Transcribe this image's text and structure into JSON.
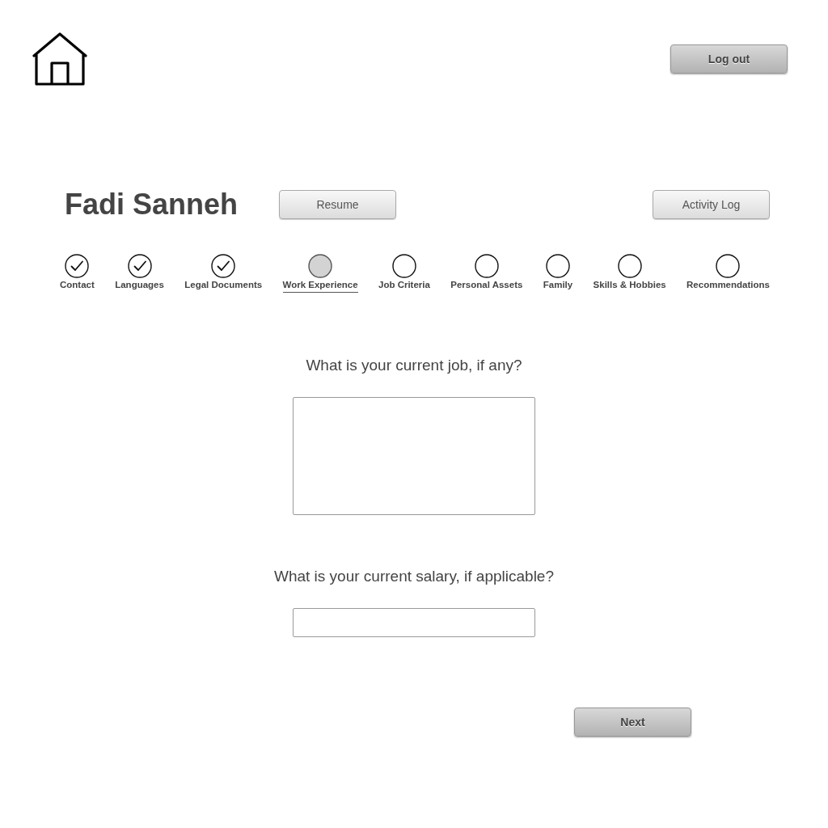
{
  "header": {
    "logout_button": "Log out"
  },
  "profile": {
    "name": "Fadi Sanneh",
    "resume_button": "Resume",
    "activity_log_button": "Activity Log"
  },
  "steps": [
    {
      "label": "Contact",
      "completed": true,
      "selected": false
    },
    {
      "label": "Languages",
      "completed": true,
      "selected": false
    },
    {
      "label": "Legal Documents",
      "completed": true,
      "selected": false
    },
    {
      "label": "Work Experience",
      "completed": false,
      "selected": true
    },
    {
      "label": "Job Criteria",
      "completed": false,
      "selected": false
    },
    {
      "label": "Personal Assets",
      "completed": false,
      "selected": false
    },
    {
      "label": "Family",
      "completed": false,
      "selected": false
    },
    {
      "label": "Skills & Hobbies",
      "completed": false,
      "selected": false
    },
    {
      "label": "Recommendations",
      "completed": false,
      "selected": false
    }
  ],
  "questions": [
    {
      "kind": "textarea",
      "prompt": "What is your current job, if any?"
    },
    {
      "kind": "input",
      "prompt": "What is your current salary, if applicable?"
    }
  ],
  "footer": {
    "next_button": "Next"
  }
}
